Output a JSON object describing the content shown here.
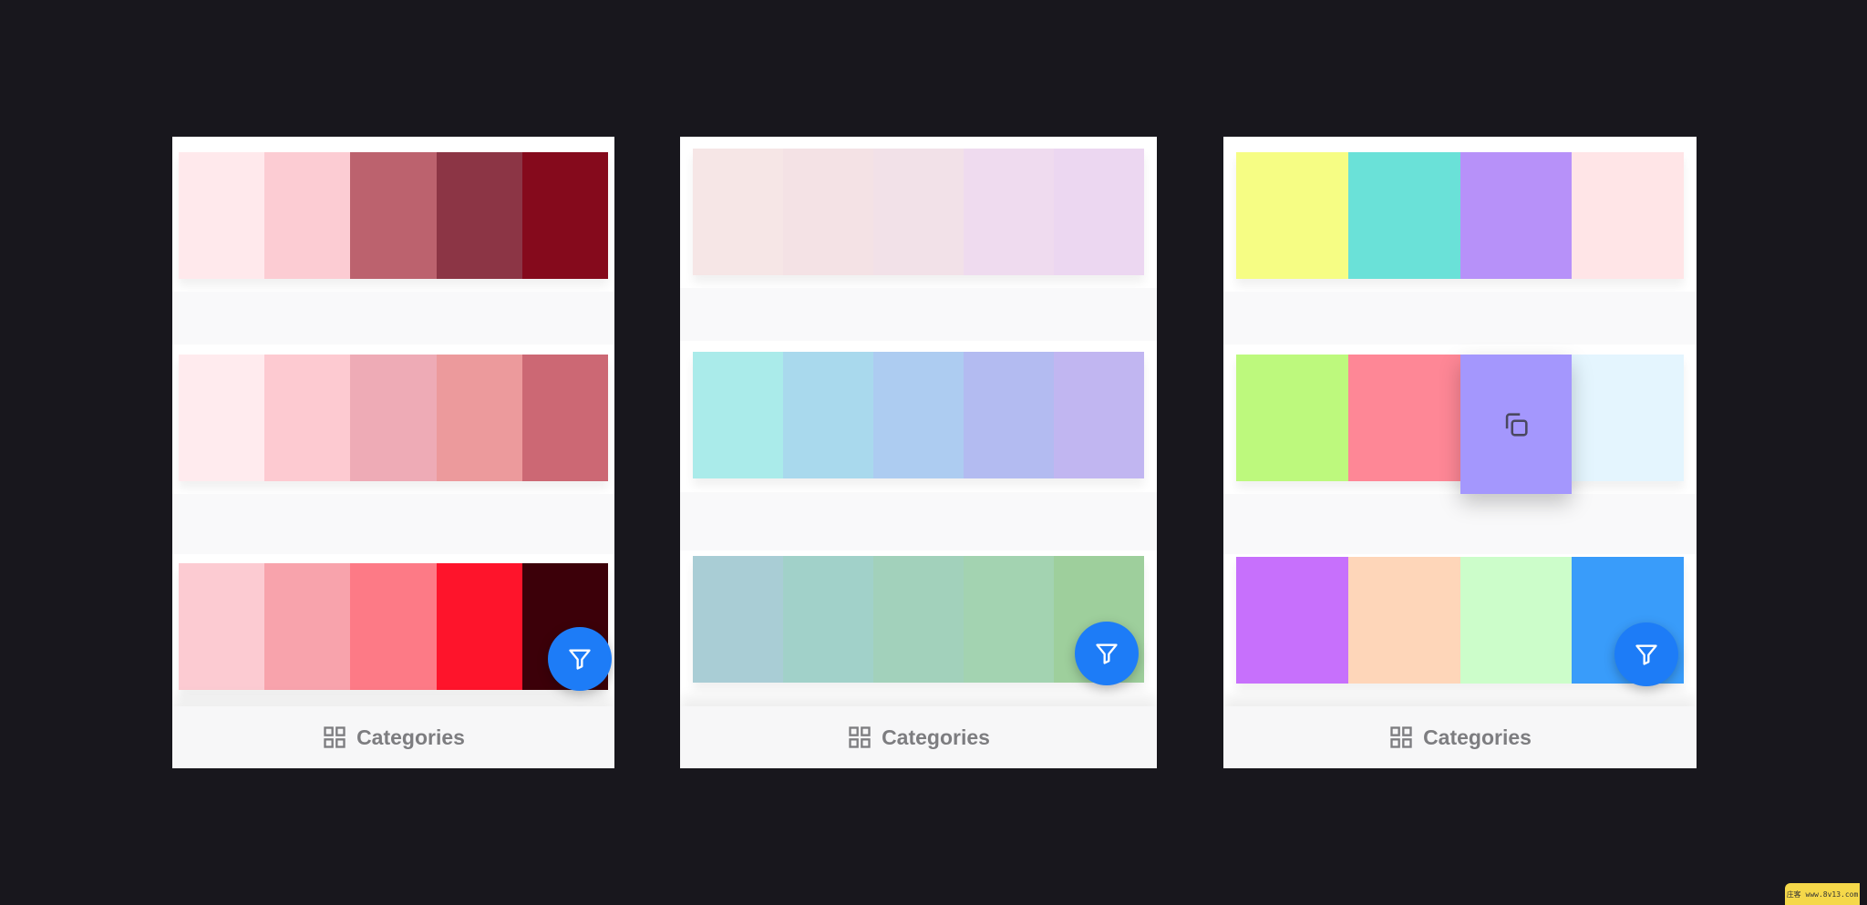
{
  "bottom_bar": {
    "label": "Categories",
    "icon": "grid-icon"
  },
  "fab_icon": "filter-icon",
  "copy_icon": "copy-icon",
  "watermark": "庄客 www.8v13.com",
  "phones": [
    {
      "palettes": [
        [
          "#ffe9ec",
          "#fcccd3",
          "#bc626e",
          "#8c3545",
          "#850a1c"
        ],
        [
          "#ffebee",
          "#fdcad1",
          "#eeabb6",
          "#ec9a9c",
          "#cc6874"
        ],
        [
          "#fccbd2",
          "#f8a3ac",
          "#fd7a86",
          "#fe142b",
          "#3c0009"
        ]
      ]
    },
    {
      "palettes": [
        [
          "#f6e6e6",
          "#f4e2e5",
          "#f2e1e8",
          "#efdbef",
          "#ecd7f1"
        ],
        [
          "#aaebea",
          "#a9d9ed",
          "#adccf1",
          "#b3bbf1",
          "#c1b6f1"
        ],
        [
          "#a9cdd5",
          "#a1d1c9",
          "#a2d1bb",
          "#a3d3b1",
          "#9ecf9c"
        ]
      ]
    },
    {
      "palettes": [
        [
          "#f6fd84",
          "#6ae1d8",
          "#b791f9",
          "#ffe5e7"
        ],
        [
          "#bdf97d",
          "#fe8796",
          "#a497fd",
          "#e4f5fe"
        ],
        [
          "#c770fc",
          "#fed6b9",
          "#ccfdca",
          "#399cfa"
        ]
      ]
    }
  ]
}
